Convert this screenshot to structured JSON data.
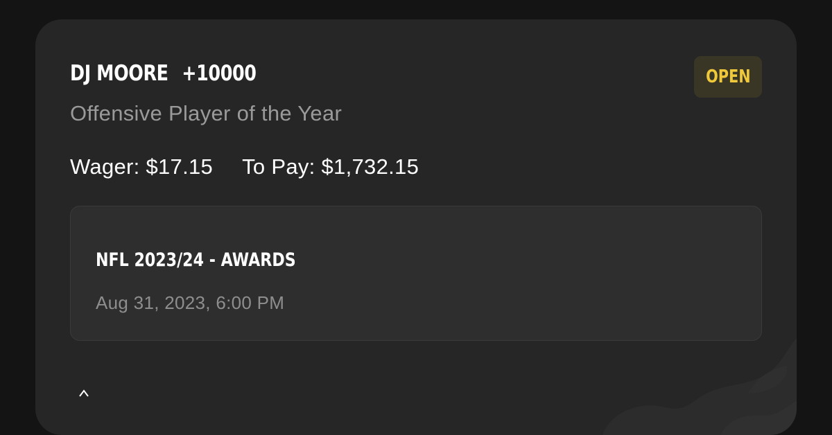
{
  "bet": {
    "player": "DJ MOORE",
    "odds": "+10000",
    "market": "Offensive Player of the Year",
    "wager_text": "Wager: $17.15",
    "to_pay_text": "To Pay: $1,732.15",
    "status": "OPEN"
  },
  "event": {
    "name": "NFL 2023/24 - AWARDS",
    "date": "Aug 31, 2023, 6:00 PM"
  },
  "colors": {
    "background": "#141414",
    "card": "#262626",
    "event_box": "#2e2e2e",
    "status_badge_bg": "#3a3626",
    "status_text": "#f0c93a",
    "primary_text": "#ffffff",
    "secondary_text": "#9a9a9a"
  },
  "icons": {
    "watermark": "brand-watermark-icon",
    "bottom": "chevron-up-icon"
  }
}
